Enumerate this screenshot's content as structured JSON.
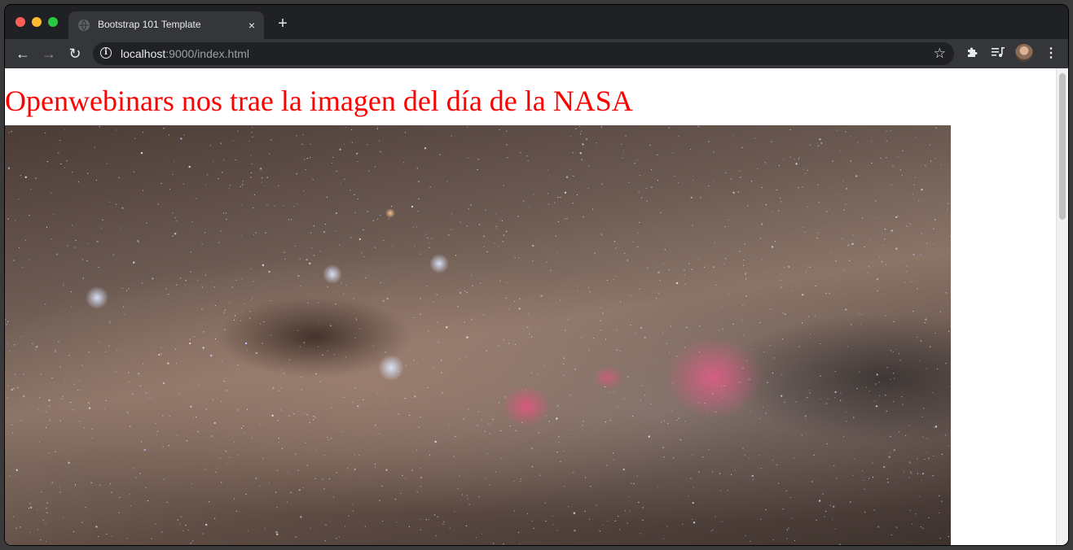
{
  "browser": {
    "tab": {
      "title": "Bootstrap 101 Template",
      "close_glyph": "×",
      "favicon": "globe-icon"
    },
    "new_tab_glyph": "+",
    "url": {
      "host": "localhost",
      "rest": ":9000/index.html"
    },
    "icons": {
      "back": "←",
      "forward": "→",
      "reload": "↻",
      "info": "i",
      "star": "☆",
      "extensions": "puzzle-icon",
      "media": "media-queue-icon",
      "menu": "⋮"
    }
  },
  "page": {
    "heading": "Openwebinars nos trae la imagen del día de la NASA",
    "heading_color": "#ff0000",
    "image": {
      "subject": "Milky Way starfield with bright blue stars and pink nebulae",
      "alt": ""
    }
  },
  "colors": {
    "chrome_dark": "#202124",
    "chrome_toolbar": "#35363a",
    "text_light": "#e8eaed",
    "close_dot": "#ff5f57",
    "minimize_dot": "#febc2e",
    "maximize_dot": "#28c840"
  }
}
